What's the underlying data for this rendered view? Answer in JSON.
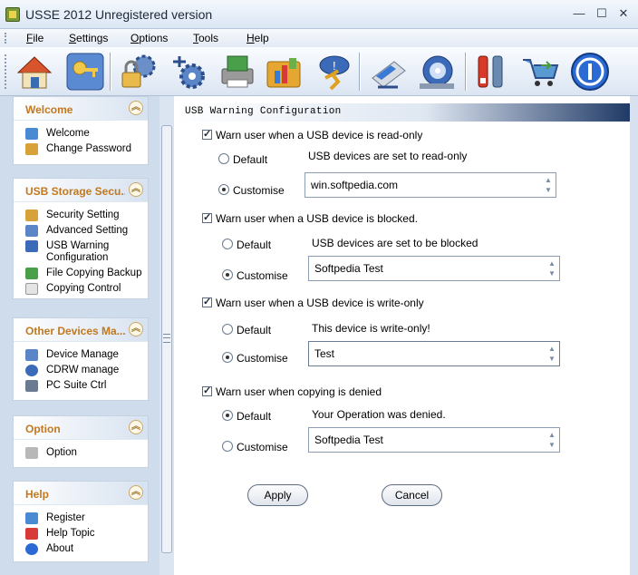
{
  "window": {
    "title": "USSE 2012 Unregistered version",
    "minimize": "—",
    "maximize": "☐",
    "close": "✕"
  },
  "menu": [
    {
      "hot": "F",
      "rest": "ile"
    },
    {
      "hot": "S",
      "rest": "ettings"
    },
    {
      "hot": "O",
      "rest": "ptions"
    },
    {
      "hot": "T",
      "rest": "ools"
    },
    {
      "hot": "H",
      "rest": "elp"
    }
  ],
  "toolbar": {
    "icons": [
      "home-icon",
      "keys-icon",
      "lock-gear-icon",
      "usb-gear-icon",
      "printer-icon",
      "folder-chart-icon",
      "runner-chat-icon",
      "device-network-icon",
      "disc-icon",
      "tools-icon",
      "cart-icon",
      "info-icon"
    ],
    "colors": {
      "accent": "#c2781e",
      "header_dark": "#203a66"
    }
  },
  "sidebar": {
    "groups": [
      {
        "title": "Welcome",
        "items": [
          {
            "label": "Welcome",
            "icon": "welcome-icon"
          },
          {
            "label": "Change Password",
            "icon": "key-icon"
          }
        ]
      },
      {
        "title": "USB Storage Secu...",
        "items": [
          {
            "label": "Security Setting",
            "icon": "security-icon"
          },
          {
            "label": "Advanced Setting",
            "icon": "advanced-icon"
          },
          {
            "label": "USB Warning Configuration",
            "icon": "usb-warning-icon"
          },
          {
            "label": "File Copying Backup",
            "icon": "backup-icon"
          },
          {
            "label": "Copying Control",
            "icon": "copy-icon"
          }
        ]
      },
      {
        "title": "Other Devices Ma...",
        "items": [
          {
            "label": "Device Manage",
            "icon": "device-icon"
          },
          {
            "label": "CDRW manage",
            "icon": "cdrw-icon"
          },
          {
            "label": "PC Suite Ctrl",
            "icon": "phone-icon"
          }
        ]
      },
      {
        "title": "Option",
        "items": [
          {
            "label": "Option",
            "icon": "option-icon"
          }
        ]
      },
      {
        "title": "Help",
        "items": [
          {
            "label": "Register",
            "icon": "register-icon"
          },
          {
            "label": "Help Topic",
            "icon": "help-icon"
          },
          {
            "label": "About",
            "icon": "about-icon"
          }
        ]
      }
    ]
  },
  "content": {
    "header": "USB Warning Configuration",
    "default_label": "Default",
    "customise_label": "Customise",
    "sections": [
      {
        "label": "Warn user when a USB device is read-only",
        "checked": true,
        "default_msg": "USB devices are set to read-only",
        "selected": "customise",
        "custom_value": "win.softpedia.com"
      },
      {
        "label": "Warn user when a USB device is blocked.",
        "checked": true,
        "default_msg": "USB devices are set to be blocked",
        "selected": "customise",
        "custom_value": "Softpedia Test"
      },
      {
        "label": "Warn user when a USB device is write-only",
        "checked": true,
        "default_msg": "This device is write-only!",
        "selected": "customise",
        "custom_value": "Test"
      },
      {
        "label": "Warn user when copying is denied",
        "checked": true,
        "default_msg": "Your Operation was denied.",
        "selected": "default",
        "custom_value": "Softpedia Test"
      }
    ],
    "apply": "Apply",
    "cancel": "Cancel"
  }
}
